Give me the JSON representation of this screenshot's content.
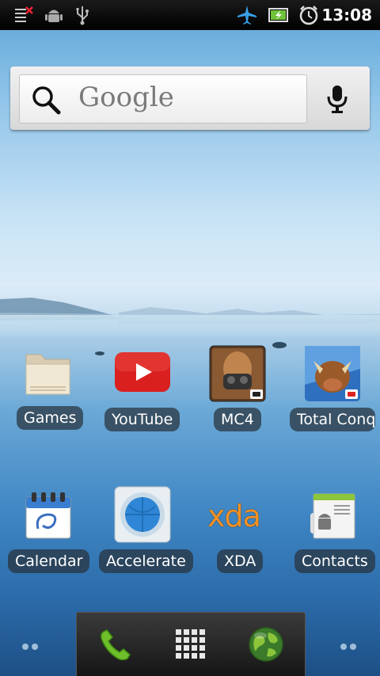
{
  "status_bar": {
    "time": "13:08",
    "left_icons": [
      "notification-list-icon",
      "android-debug-icon",
      "usb-icon"
    ],
    "right_icons": [
      "airplane-mode-icon",
      "battery-charging-icon",
      "alarm-clock-icon"
    ]
  },
  "search_widget": {
    "text": "Google",
    "icons": [
      "search-icon",
      "microphone-icon"
    ]
  },
  "home_apps": [
    {
      "label": "Games",
      "icon": "folder-icon"
    },
    {
      "label": "YouTube",
      "icon": "youtube-icon"
    },
    {
      "label": "MC4",
      "icon": "mc4-game-icon"
    },
    {
      "label": "Total Conq",
      "icon": "total-conquest-icon"
    },
    {
      "label": "Calendar",
      "icon": "calendar-icon"
    },
    {
      "label": "Accelerate",
      "icon": "accelerate-icon"
    },
    {
      "label": "XDA",
      "icon": "xda-icon"
    },
    {
      "label": "Contacts",
      "icon": "contacts-icon"
    }
  ],
  "xda_logo_text": "xda",
  "dock": {
    "icons": [
      "phone-icon",
      "app-drawer-icon",
      "browser-globe-icon"
    ]
  },
  "colors": {
    "youtube_red": "#d9201f",
    "xda_orange": "#f39124",
    "phone_green": "#6fbf2a"
  }
}
